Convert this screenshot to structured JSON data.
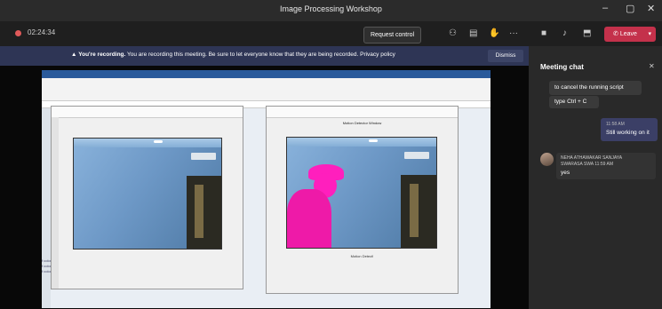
{
  "window": {
    "title": "Image Processing Workshop",
    "controls": [
      "–",
      "▢",
      "✕"
    ]
  },
  "toolbar": {
    "timer": "02:24:34",
    "request_control": "Request control",
    "leave_label": "Leave"
  },
  "banner": {
    "heading": "You're recording.",
    "message": "You are recording this meeting. Be sure to let everyone know that they are being recorded. Privacy policy",
    "dismiss": "Dismiss"
  },
  "shared_screen": {
    "figure_right_title": "Motion Detector Window",
    "figure_right_caption": "Motion Detect!",
    "command_rows": [
      "f colorImageML",
      "f colorImageM2",
      "f colorImageM3"
    ],
    "workspace_rows": [
      "NNImageData(1)...",
      "NNImageData(2)...",
      "NNImageData(3)..."
    ]
  },
  "chat": {
    "title": "Meeting chat",
    "messages_received_top": [
      "to cancel the running script",
      "type Ctrl + C"
    ],
    "my_message": {
      "time": "11:58 AM",
      "text": "Still working on it"
    },
    "other_message": {
      "sender": "NEHA ATHAWAKAR SANJAYA",
      "sender_line2": "SWARASA  SWA",
      "time": "11:59 AM",
      "text": "yes"
    }
  },
  "colors": {
    "accent_leave": "#c4314b",
    "banner": "#2e3555",
    "highlight_person": "#ff1fbd"
  }
}
